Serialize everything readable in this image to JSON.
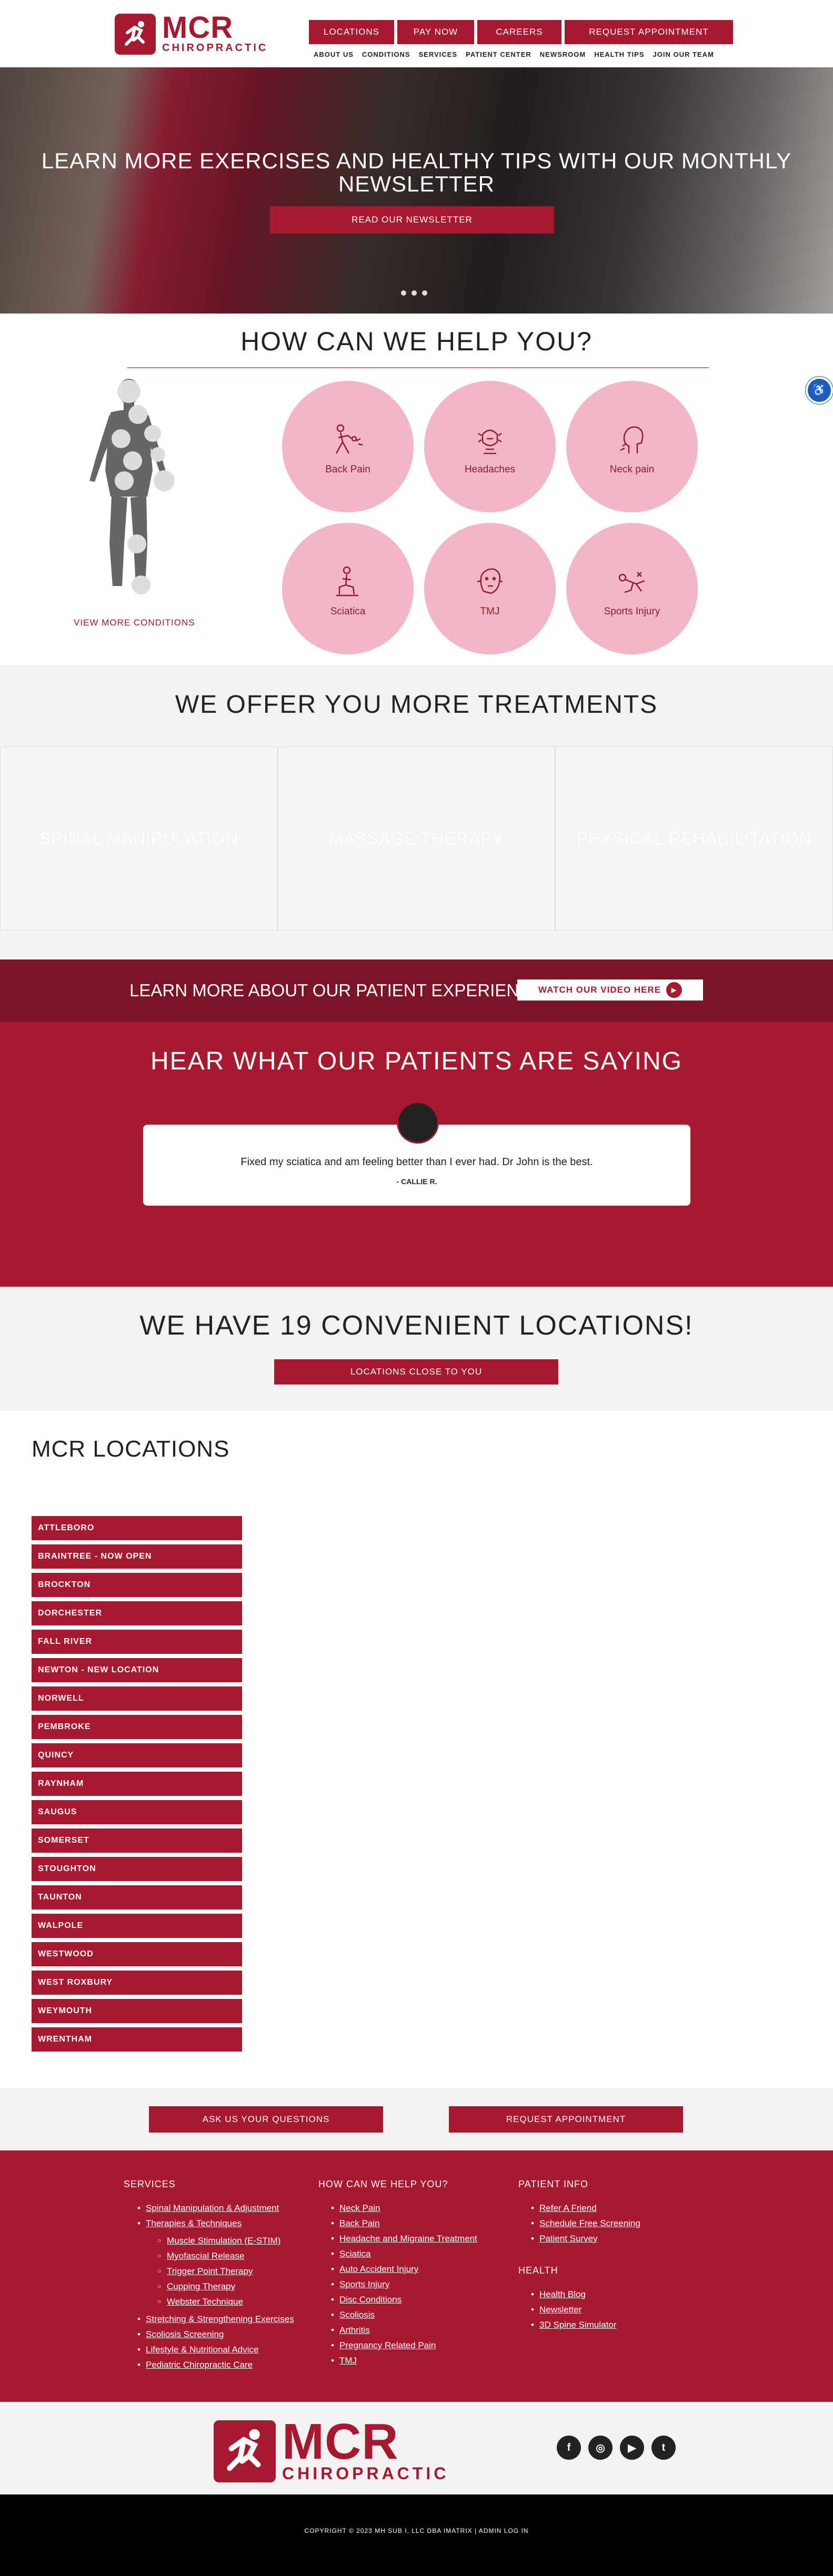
{
  "header": {
    "logo_mcr": "MCR",
    "logo_chiro": "CHIROPRACTIC",
    "top_buttons": [
      "LOCATIONS",
      "PAY NOW",
      "CAREERS",
      "REQUEST APPOINTMENT"
    ],
    "sub_nav": [
      "ABOUT US",
      "CONDITIONS",
      "SERVICES",
      "PATIENT CENTER",
      "NEWSROOM",
      "HEALTH TIPS",
      "JOIN OUR TEAM"
    ]
  },
  "hero": {
    "title": "LEARN MORE EXERCISES AND HEALTHY TIPS WITH OUR MONTHLY NEWSLETTER",
    "button": "READ OUR NEWSLETTER"
  },
  "help": {
    "title": "HOW CAN WE HELP YOU?",
    "view_more": "VIEW MORE CONDITIONS",
    "conditions": [
      {
        "label": "Back Pain",
        "icon": "back-pain-icon"
      },
      {
        "label": "Headaches",
        "icon": "headache-icon"
      },
      {
        "label": "Neck pain",
        "icon": "neck-pain-icon"
      },
      {
        "label": "Sciatica",
        "icon": "sciatica-icon"
      },
      {
        "label": "TMJ",
        "icon": "tmj-icon"
      },
      {
        "label": "Sports Injury",
        "icon": "sports-injury-icon"
      }
    ]
  },
  "treatments": {
    "title": "WE OFFER YOU MORE TREATMENTS",
    "cards": [
      "SPINAL MANIPULATION",
      "MASSAGE THERAPY",
      "PHYSICAL REHABILITATION"
    ]
  },
  "experience": {
    "text": "LEARN MORE ABOUT OUR PATIENT EXPERIENCE",
    "button": "WATCH OUR VIDEO HERE"
  },
  "testimonials": {
    "title": "HEAR WHAT OUR PATIENTS ARE SAYING",
    "quote": "Fixed my sciatica and am feeling better than I ever had. Dr John is the best.",
    "author": "- CALLIE R."
  },
  "locations_banner": {
    "title": "WE HAVE 19 CONVENIENT LOCATIONS!",
    "button": "LOCATIONS CLOSE TO YOU"
  },
  "mcr_locations": {
    "title": "MCR LOCATIONS",
    "items": [
      "ATTLEBORO",
      "BRAINTREE - NOW OPEN",
      "BROCKTON",
      "DORCHESTER",
      "FALL RIVER",
      "NEWTON - NEW LOCATION",
      "NORWELL",
      "PEMBROKE",
      "QUINCY",
      "RAYNHAM",
      "SAUGUS",
      "SOMERSET",
      "STOUGHTON",
      "TAUNTON",
      "WALPOLE",
      "WESTWOOD",
      "WEST ROXBURY",
      "WEYMOUTH",
      "WRENTHAM"
    ]
  },
  "cta": {
    "ask": "ASK US YOUR QUESTIONS",
    "request": "REQUEST APPOINTMENT"
  },
  "footer": {
    "services_title": "SERVICES",
    "services_a": [
      "Spinal Manipulation & Adjustment",
      "Therapies & Techniques"
    ],
    "services_sub": [
      "Muscle Stimulation (E-STIM)",
      "Myofascial Release",
      "Trigger Point Therapy",
      "Cupping Therapy",
      "Webster Technique"
    ],
    "services_b": [
      "Stretching & Strengthening Exercises",
      "Scoliosis Screening",
      "Lifestyle & Nutritional Advice",
      "Pediatric Chiropractic Care"
    ],
    "help_title": "HOW CAN WE HELP YOU?",
    "help_items": [
      "Neck Pain",
      "Back Pain",
      "Headache and Migraine Treatment",
      "Sciatica",
      "Auto Accident Injury",
      "Sports Injury",
      "Disc Conditions",
      "Scoliosis",
      "Arthritis",
      "Pregnancy Related Pain",
      "TMJ"
    ],
    "patient_title": "PATIENT INFO",
    "patient_items": [
      "Refer A Friend",
      "Schedule Free Screening",
      "Patient Survey"
    ],
    "health_title": "HEALTH",
    "health_items": [
      "Health Blog",
      "Newsletter",
      "3D Spine Simulator"
    ]
  },
  "socials": [
    {
      "name": "facebook-icon",
      "glyph": "f"
    },
    {
      "name": "instagram-icon",
      "glyph": "◎"
    },
    {
      "name": "youtube-icon",
      "glyph": "▶"
    },
    {
      "name": "twitter-icon",
      "glyph": "t"
    }
  ],
  "copyright": "COPYRIGHT © 2023 MH SUB I, LLC DBA IMATRIX  |  ADMIN LOG IN",
  "colors": {
    "brand": "#a6192e",
    "brand_dark": "#7a1426",
    "pink": "#f3b6c5"
  }
}
